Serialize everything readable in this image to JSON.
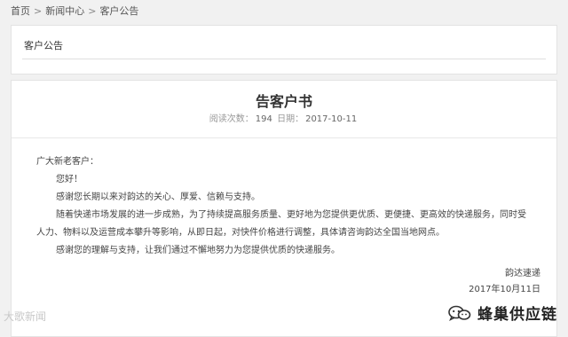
{
  "breadcrumb": {
    "items": [
      "首页",
      "新闻中心",
      "客户公告"
    ],
    "separator": ">"
  },
  "section": {
    "title": "客户公告"
  },
  "article": {
    "title": "告客户书",
    "meta": {
      "views_label": "阅读次数：",
      "views": "194",
      "date_label": "日期：",
      "date": "2017-10-11"
    },
    "salutation": "广大新老客户：",
    "paragraphs": [
      "您好！",
      "感谢您长期以来对韵达的关心、厚爱、信赖与支持。",
      "随着快递市场发展的进一步成熟，为了持续提高服务质量、更好地为您提供更优质、更便捷、更高效的快递服务，同时受人力、物料以及运营成本攀升等影响，从即日起，对快件价格进行调整，具体请咨询韵达全国当地网点。",
      "感谢您的理解与支持，让我们通过不懈地努力为您提供优质的快递服务。"
    ],
    "signature": {
      "company": "韵达速递",
      "date": "2017年10月11日"
    }
  },
  "watermarks": {
    "left": "大歌新闻",
    "right": "蜂巢供应链",
    "right_icon": "wechat-logo"
  },
  "colors": {
    "page_bg": "#f1f1f1",
    "panel_bg": "#ffffff",
    "text": "#333333"
  }
}
